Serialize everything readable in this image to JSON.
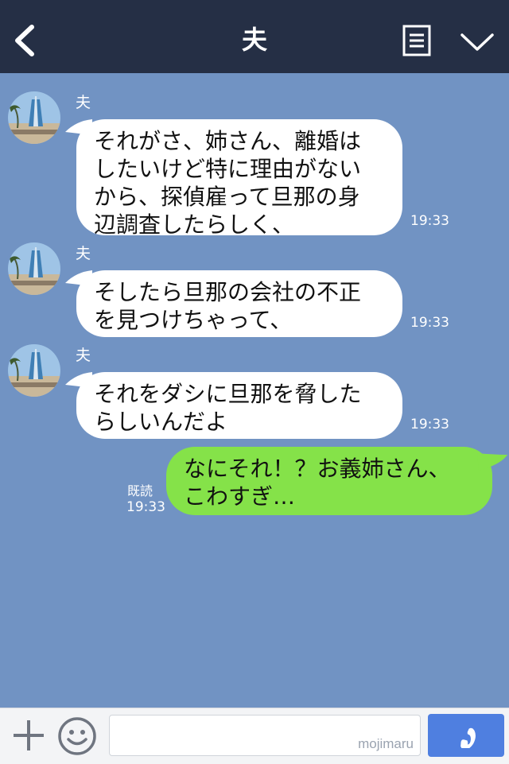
{
  "header": {
    "title": "夫",
    "back_icon": "chevron-left-icon",
    "notes_icon": "notes-icon",
    "menu_icon": "chevron-down-icon"
  },
  "messages": [
    {
      "sender": "夫",
      "text": "それがさ、姉さん、離婚は\nしたいけど特に理由がない\nから、探偵雇って旦那の身\n辺調査したらしく、",
      "time": "19:33"
    },
    {
      "sender": "夫",
      "text": "そしたら旦那の会社の不正\nを見つけちゃって、",
      "time": "19:33"
    },
    {
      "sender": "夫",
      "text": "それをダシに旦那を脅した\nらしいんだよ",
      "time": "19:33"
    },
    {
      "text": "なにそれ！？お義姉さん、\nこわすぎ…",
      "read": "既読",
      "time": "19:33"
    }
  ],
  "input": {
    "placeholder": "",
    "watermark": "mojimaru",
    "plus_icon": "plus-icon",
    "smiley_icon": "smiley-icon",
    "call_icon": "phone-icon"
  },
  "colors": {
    "header_bg": "#252f45",
    "chat_bg": "#7193c3",
    "incoming_bubble": "#ffffff",
    "outgoing_bubble": "#85e249",
    "call_button": "#4f7fe0"
  }
}
